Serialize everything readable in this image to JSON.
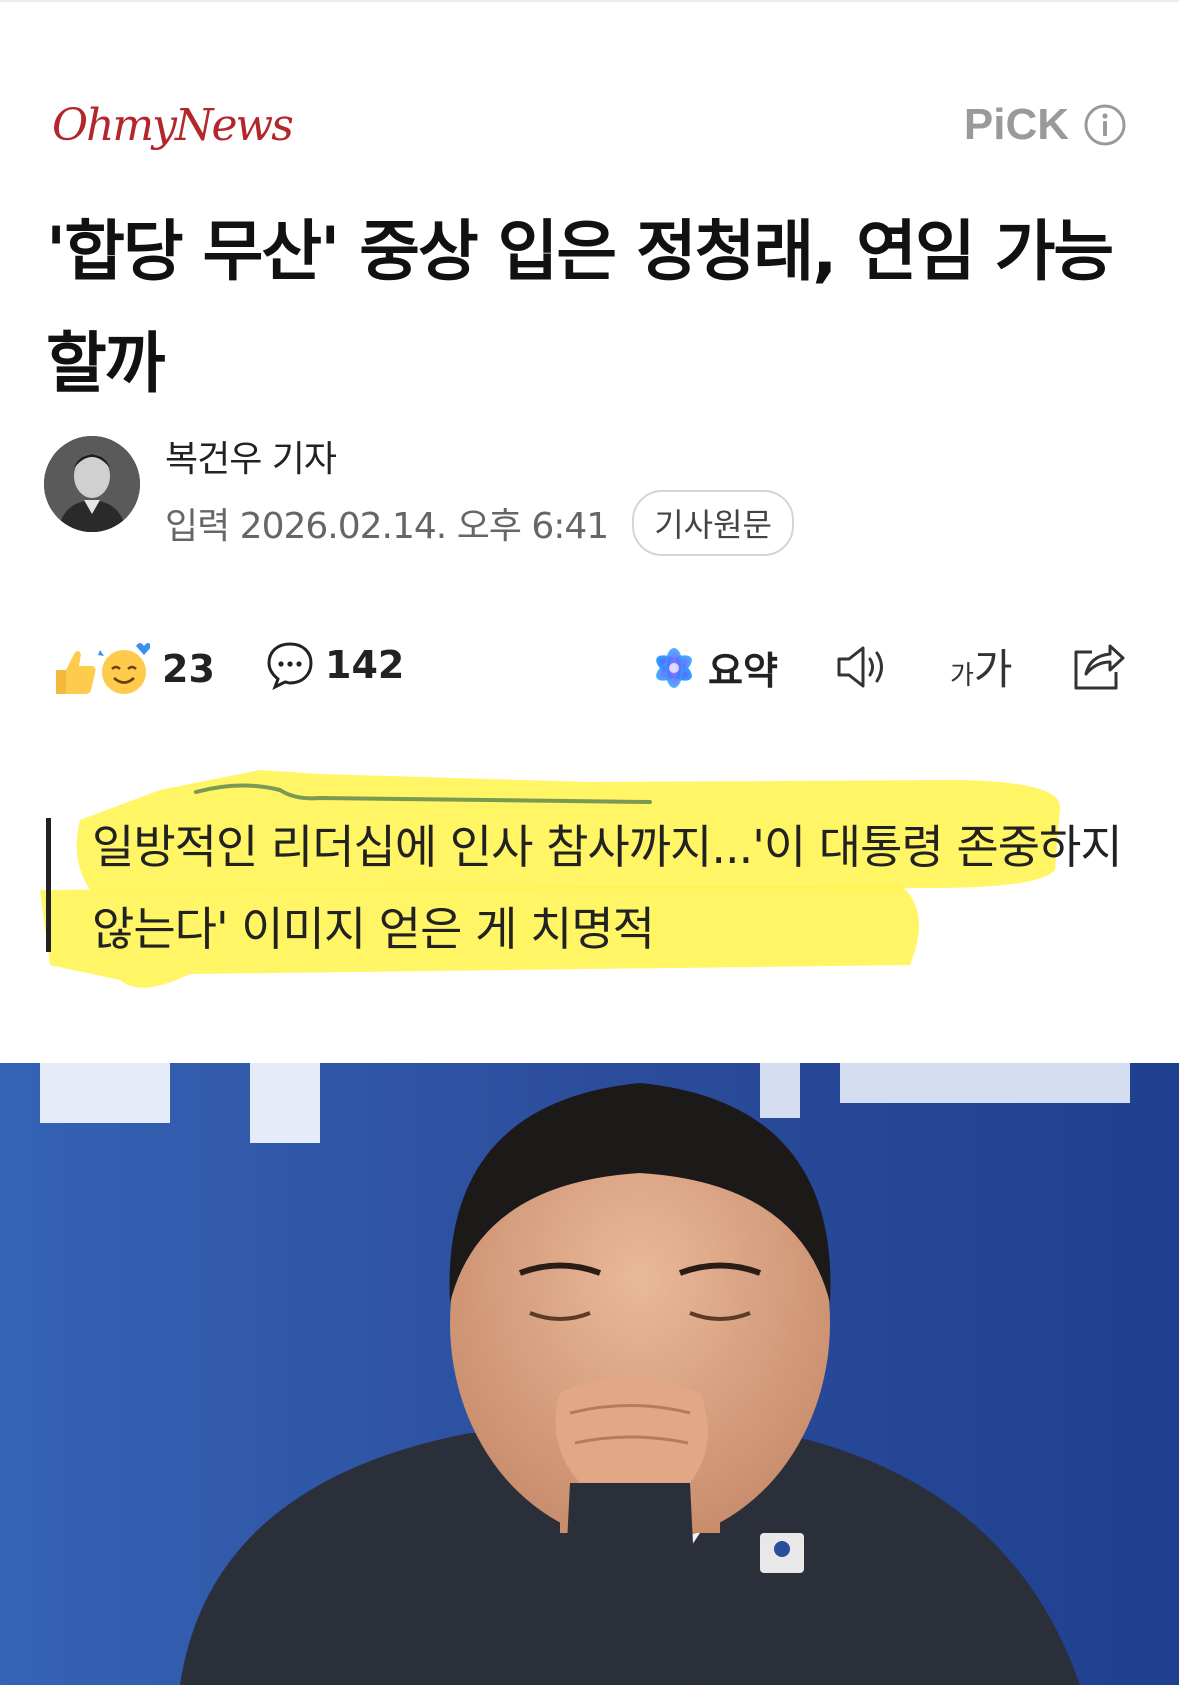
{
  "header": {
    "press_name": "OhmyNews",
    "pick_label": "PiCK"
  },
  "article": {
    "headline": "'합당 무산' 중상 입은 정청래, 연임 가능할까",
    "reporter": "복건우 기자",
    "published": "입력 2026.02.14. 오후 6:41",
    "source_button": "기사원문",
    "subtitle": "일방적인 리더십에 인사 참사까지...'이 대통령 존중하지 않는다' 이미지 얻은 게 치명적"
  },
  "actions": {
    "reaction_count": "23",
    "comment_count": "142",
    "summary_label": "요약",
    "font_small": "가",
    "font_large": "가"
  },
  "colors": {
    "press_red": "#b3262b",
    "highlight_yellow": "#fff34a",
    "photo_blue": "#2c4d9c"
  }
}
